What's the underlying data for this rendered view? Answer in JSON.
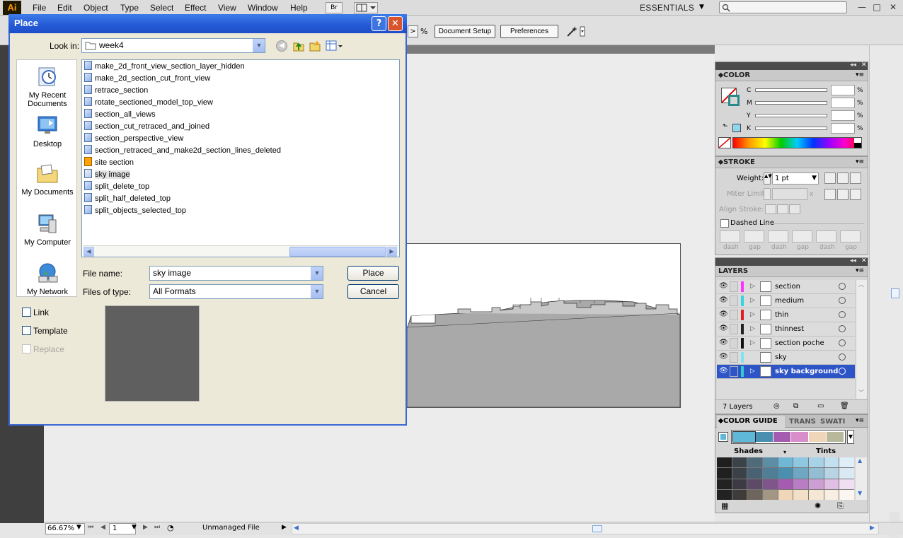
{
  "app": {
    "logo": "Ai",
    "menus": [
      "File",
      "Edit",
      "Object",
      "Type",
      "Select",
      "Effect",
      "View",
      "Window",
      "Help"
    ],
    "bridge_label": "Br",
    "workspace": "ESSENTIALS",
    "window_controls": [
      "—",
      "□",
      "✕"
    ]
  },
  "controlbar": {
    "percent_suffix": "%",
    "document_setup": "Document Setup",
    "preferences": "Preferences"
  },
  "color_panel": {
    "tab": "COLOR",
    "channels": [
      {
        "label": "C",
        "value": "",
        "unit": "%"
      },
      {
        "label": "M",
        "value": "",
        "unit": "%"
      },
      {
        "label": "Y",
        "value": "",
        "unit": "%"
      },
      {
        "label": "K",
        "value": "",
        "unit": "%"
      }
    ]
  },
  "stroke_panel": {
    "tab": "STROKE",
    "weight_label": "Weight:",
    "weight_value": "1 pt",
    "miter_label": "Miter Limit:",
    "miter_unit": "x",
    "align_label": "Align Stroke:",
    "dashed_label": "Dashed Line",
    "dash_labels": [
      "dash",
      "gap",
      "dash",
      "gap",
      "dash",
      "gap"
    ]
  },
  "layers_panel": {
    "tab": "LAYERS",
    "layers": [
      {
        "name": "section",
        "color": "#ff33ff",
        "selected": false,
        "expand": true
      },
      {
        "name": "medium",
        "color": "#33d5e0",
        "selected": false,
        "expand": true
      },
      {
        "name": "thin",
        "color": "#e02020",
        "selected": false,
        "expand": true
      },
      {
        "name": "thinnest",
        "color": "#222222",
        "selected": false,
        "expand": true
      },
      {
        "name": "section poche",
        "color": "#111111",
        "selected": false,
        "expand": true
      },
      {
        "name": "sky",
        "color": "#7fe5ee",
        "selected": false,
        "expand": false
      },
      {
        "name": "sky background",
        "color": "#33cccc",
        "selected": true,
        "expand": true
      }
    ],
    "count": "7 Layers"
  },
  "color_guide": {
    "tabs": [
      "COLOR GUIDE",
      "TRANS",
      "SWATI"
    ],
    "shades_label": "Shades",
    "tints_label": "Tints",
    "harmony": [
      "#5fb8d8",
      "#4a8fb0",
      "#a45bb0",
      "#d98ecb",
      "#f0d6b8",
      "#b8b89a"
    ]
  },
  "status": {
    "zoom": "66.67%",
    "page": "1",
    "info": "Unmanaged File"
  },
  "dialog": {
    "title": "Place",
    "help_btn": "?",
    "close_btn": "✕",
    "look_in_label": "Look in:",
    "look_in_value": "week4",
    "places": [
      "My Recent Documents",
      "Desktop",
      "My Documents",
      "My Computer",
      "My Network"
    ],
    "files": [
      {
        "name": "make_2d_front_view_section_layer_hidden",
        "type": "doc"
      },
      {
        "name": "make_2d_section_cut_front_view",
        "type": "doc"
      },
      {
        "name": "retrace_section",
        "type": "doc"
      },
      {
        "name": "rotate_sectioned_model_top_view",
        "type": "doc"
      },
      {
        "name": "section_all_views",
        "type": "doc"
      },
      {
        "name": "section_cut_retraced_and_joined",
        "type": "doc"
      },
      {
        "name": "section_perspective_view",
        "type": "doc"
      },
      {
        "name": "section_retraced_and_make2d_section_lines_deleted",
        "type": "doc"
      },
      {
        "name": "site section",
        "type": "ai"
      },
      {
        "name": "sky image",
        "type": "img"
      },
      {
        "name": "split_delete_top",
        "type": "doc"
      },
      {
        "name": "split_half_deleted_top",
        "type": "doc"
      },
      {
        "name": "split_objects_selected_top",
        "type": "doc"
      }
    ],
    "file_name_label": "File name:",
    "file_name_value": "sky image",
    "file_type_label": "Files of type:",
    "file_type_value": "All Formats",
    "place_button": "Place",
    "cancel_button": "Cancel",
    "link_label": "Link",
    "template_label": "Template",
    "replace_label": "Replace"
  }
}
